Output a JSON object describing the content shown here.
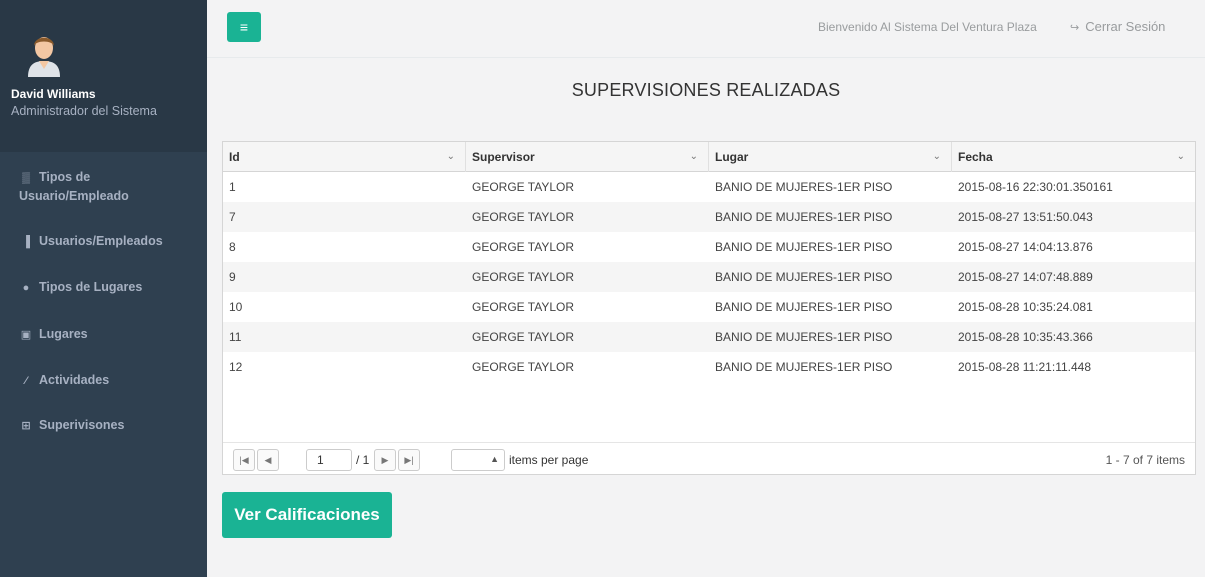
{
  "sidebar": {
    "user_name": "David Williams",
    "user_role": "Administrador del Sistema",
    "items": [
      {
        "label": "Tipos de\nUsuario/Empleado",
        "icon": "sitemap-icon",
        "glyph": "▒"
      },
      {
        "label": "Usuarios/Empleados",
        "icon": "bar-chart-icon",
        "glyph": "▐"
      },
      {
        "label": "Tipos de Lugares",
        "icon": "globe-icon",
        "glyph": "●"
      },
      {
        "label": "Lugares",
        "icon": "picture-icon",
        "glyph": "▣"
      },
      {
        "label": "Actividades",
        "icon": "magic-wand-icon",
        "glyph": "⁄"
      },
      {
        "label": "Superivisones",
        "icon": "table-icon",
        "glyph": "⊞"
      }
    ]
  },
  "topbar": {
    "menu_glyph": "≡",
    "welcome": "Bienvenido Al Sistema Del Ventura Plaza",
    "logout": "Cerrar Sesión",
    "logout_glyph": "↪"
  },
  "page_title": "SUPERVISIONES REALIZADAS",
  "table": {
    "columns": [
      "Id",
      "Supervisor",
      "Lugar",
      "Fecha"
    ],
    "rows": [
      [
        "1",
        "GEORGE TAYLOR",
        "BANIO DE MUJERES-1ER PISO",
        "2015-08-16 22:30:01.350161"
      ],
      [
        "7",
        "GEORGE TAYLOR",
        "BANIO DE MUJERES-1ER PISO",
        "2015-08-27 13:51:50.043"
      ],
      [
        "8",
        "GEORGE TAYLOR",
        "BANIO DE MUJERES-1ER PISO",
        "2015-08-27 14:04:13.876"
      ],
      [
        "9",
        "GEORGE TAYLOR",
        "BANIO DE MUJERES-1ER PISO",
        "2015-08-27 14:07:48.889"
      ],
      [
        "10",
        "GEORGE TAYLOR",
        "BANIO DE MUJERES-1ER PISO",
        "2015-08-28 10:35:24.081"
      ],
      [
        "11",
        "GEORGE TAYLOR",
        "BANIO DE MUJERES-1ER PISO",
        "2015-08-28 10:35:43.366"
      ],
      [
        "12",
        "GEORGE TAYLOR",
        "BANIO DE MUJERES-1ER PISO",
        "2015-08-28 11:21:11.448"
      ]
    ]
  },
  "pager": {
    "first": "|◀",
    "prev": "◀",
    "page": "1",
    "of_pages": "/ 1",
    "next": "▶",
    "last": "▶|",
    "per_page_label": "items per page",
    "items_info": "1 - 7 of 7 items"
  },
  "actions": {
    "ver_calificaciones": "Ver Calificaciones"
  },
  "colors": {
    "accent": "#1ab394",
    "sidebar": "#2f4050",
    "profile": "#293846"
  }
}
